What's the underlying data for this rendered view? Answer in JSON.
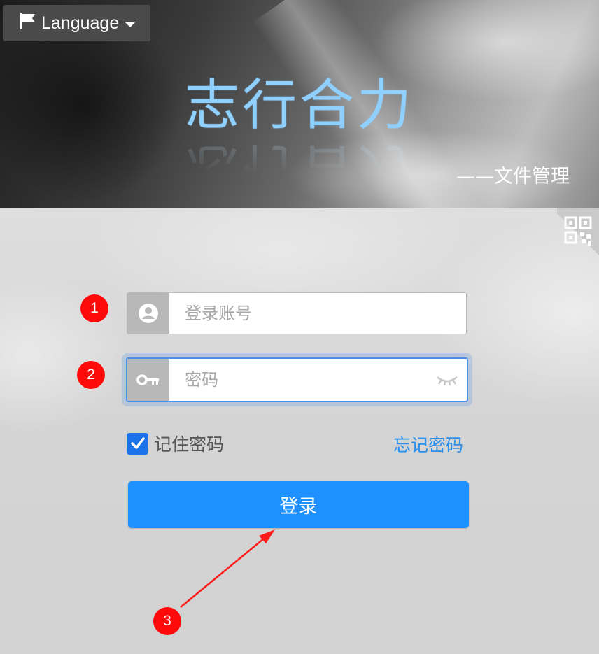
{
  "header": {
    "language_label": "Language",
    "brand_title": "志行合力",
    "brand_subtitle": "——文件管理"
  },
  "login": {
    "account_placeholder": "登录账号",
    "password_placeholder": "密码",
    "remember_label": "记住密码",
    "remember_checked": true,
    "forgot_label": "忘记密码",
    "submit_label": "登录"
  },
  "annotations": {
    "marker_1": "1",
    "marker_2": "2",
    "marker_3": "3"
  },
  "icons": {
    "language": "flag-icon",
    "dropdown": "caret-down-icon",
    "qr": "qr-code-icon",
    "user": "user-circle-icon",
    "password": "key-icon",
    "toggle_visibility": "eye-closed-icon",
    "check": "checkmark-icon"
  },
  "colors": {
    "accent": "#1e90ff",
    "brand_title": "#8fd0ff",
    "link": "#2a8ee8",
    "marker": "#ff0a0a",
    "checkbox": "#1a73e8"
  }
}
